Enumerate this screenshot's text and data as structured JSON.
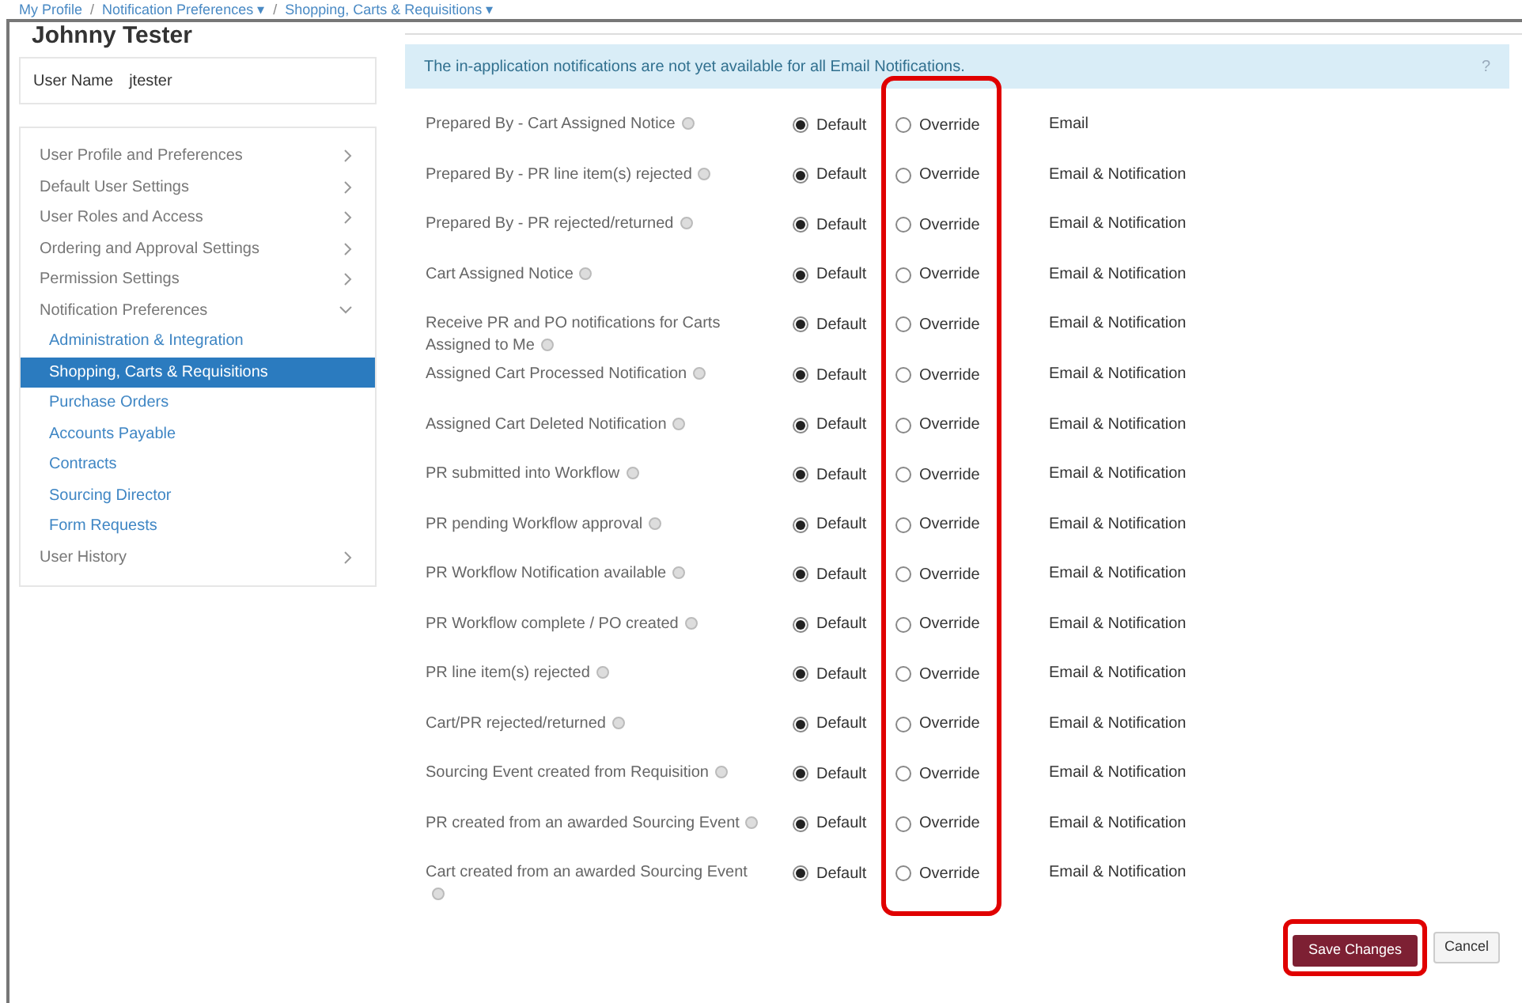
{
  "breadcrumb": [
    {
      "kind": "link",
      "text": "My Profile"
    },
    {
      "kind": "separator",
      "text": "/"
    },
    {
      "kind": "link",
      "text": "Notification Preferences ▾"
    },
    {
      "kind": "separator",
      "text": "/"
    },
    {
      "kind": "link",
      "text": "Shopping, Carts & Requisitions ▾"
    }
  ],
  "user": {
    "name": "Johnny Tester",
    "username_label": "User Name",
    "username": "jtester"
  },
  "sidebar": {
    "items": [
      {
        "label": "User Profile and Preferences",
        "expanded": false
      },
      {
        "label": "Default User Settings",
        "expanded": false
      },
      {
        "label": "User Roles and Access",
        "expanded": false
      },
      {
        "label": "Ordering and Approval Settings",
        "expanded": false
      },
      {
        "label": "Permission Settings",
        "expanded": false
      },
      {
        "label": "Notification Preferences",
        "expanded": true,
        "children": [
          {
            "label": "Administration & Integration",
            "selected": false
          },
          {
            "label": "Shopping, Carts & Requisitions",
            "selected": true
          },
          {
            "label": "Purchase Orders",
            "selected": false
          },
          {
            "label": "Accounts Payable",
            "selected": false
          },
          {
            "label": "Contracts",
            "selected": false
          },
          {
            "label": "Sourcing Director",
            "selected": false
          },
          {
            "label": "Form Requests",
            "selected": false
          }
        ]
      },
      {
        "label": "User History",
        "expanded": false
      }
    ]
  },
  "banner": {
    "text": "The in-application notifications are not yet available for all Email Notifications.",
    "help": "?"
  },
  "rows": [
    {
      "label": "Prepared By - Cart Assigned Notice",
      "default": "Default",
      "override": "Override",
      "default_selected": true,
      "delivery": "Email"
    },
    {
      "label": "Prepared By - PR line item(s) rejected",
      "default": "Default",
      "override": "Override",
      "default_selected": true,
      "delivery": "Email & Notification"
    },
    {
      "label": "Prepared By - PR rejected/returned",
      "default": "Default",
      "override": "Override",
      "default_selected": true,
      "delivery": "Email & Notification"
    },
    {
      "label": "Cart Assigned Notice",
      "default": "Default",
      "override": "Override",
      "default_selected": true,
      "delivery": "Email & Notification"
    },
    {
      "label": "Receive PR and PO notifications for Carts Assigned to Me",
      "default": "Default",
      "override": "Override",
      "default_selected": true,
      "delivery": "Email & Notification"
    },
    {
      "label": "Assigned Cart Processed Notification",
      "default": "Default",
      "override": "Override",
      "default_selected": true,
      "delivery": "Email & Notification"
    },
    {
      "label": "Assigned Cart Deleted Notification",
      "default": "Default",
      "override": "Override",
      "default_selected": true,
      "delivery": "Email & Notification"
    },
    {
      "label": "PR submitted into Workflow",
      "default": "Default",
      "override": "Override",
      "default_selected": true,
      "delivery": "Email & Notification"
    },
    {
      "label": "PR pending Workflow approval",
      "default": "Default",
      "override": "Override",
      "default_selected": true,
      "delivery": "Email & Notification"
    },
    {
      "label": "PR Workflow Notification available",
      "default": "Default",
      "override": "Override",
      "default_selected": true,
      "delivery": "Email & Notification"
    },
    {
      "label": "PR Workflow complete / PO created",
      "default": "Default",
      "override": "Override",
      "default_selected": true,
      "delivery": "Email & Notification"
    },
    {
      "label": "PR line item(s) rejected",
      "default": "Default",
      "override": "Override",
      "default_selected": true,
      "delivery": "Email & Notification"
    },
    {
      "label": "Cart/PR rejected/returned",
      "default": "Default",
      "override": "Override",
      "default_selected": true,
      "delivery": "Email & Notification"
    },
    {
      "label": "Sourcing Event created from Requisition",
      "default": "Default",
      "override": "Override",
      "default_selected": true,
      "delivery": "Email & Notification"
    },
    {
      "label": "PR created from an awarded Sourcing Event",
      "default": "Default",
      "override": "Override",
      "default_selected": true,
      "delivery": "Email & Notification"
    },
    {
      "label": "Cart created from an awarded Sourcing Event",
      "default": "Default",
      "override": "Override",
      "default_selected": true,
      "delivery": "Email & Notification"
    }
  ],
  "buttons": {
    "save": "Save Changes",
    "cancel": "Cancel"
  }
}
